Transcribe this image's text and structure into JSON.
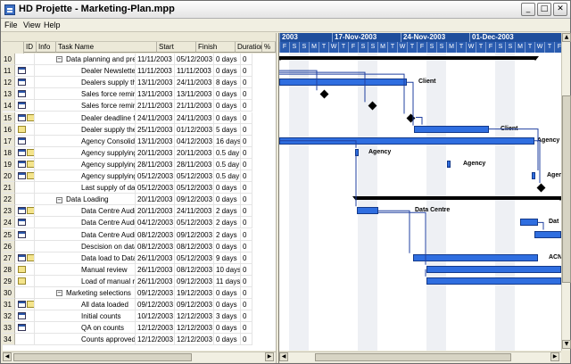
{
  "window": {
    "title": "HD Projette - Marketing-Plan.mpp",
    "minimize": "_",
    "maximize": "□",
    "close": "✕"
  },
  "menu": {
    "file": "File",
    "view": "View",
    "help": "Help"
  },
  "columns": {
    "id": "ID",
    "info": "Info",
    "name": "Task Name",
    "start": "Start",
    "finish": "Finish",
    "duration": "Duration",
    "pct": "%"
  },
  "rows": [
    {
      "id": "10",
      "info": "",
      "name": "Data planning and prep",
      "start": "11/11/2003",
      "finish": "05/12/2003",
      "dur": "0 days",
      "pct": "0",
      "summary": true
    },
    {
      "id": "11",
      "info": "cal",
      "name": "Dealer Newsletter",
      "start": "11/11/2003",
      "finish": "11/11/2003",
      "dur": "0 days",
      "pct": "0"
    },
    {
      "id": "12",
      "info": "cal",
      "name": "Dealers supply the",
      "start": "13/11/2003",
      "finish": "24/11/2003",
      "dur": "8 days",
      "pct": "0"
    },
    {
      "id": "13",
      "info": "cal",
      "name": "Sales force remind",
      "start": "13/11/2003",
      "finish": "13/11/2003",
      "dur": "0 days",
      "pct": "0"
    },
    {
      "id": "14",
      "info": "cal",
      "name": "Sales force remind",
      "start": "21/11/2003",
      "finish": "21/11/2003",
      "dur": "0 days",
      "pct": "0"
    },
    {
      "id": "15",
      "info": "calnote",
      "name": "Dealer deadline for",
      "start": "24/11/2003",
      "finish": "24/11/2003",
      "dur": "0 days",
      "pct": "0"
    },
    {
      "id": "16",
      "info": "note",
      "name": "Dealer supply the c",
      "start": "25/11/2003",
      "finish": "01/12/2003",
      "dur": "5 days",
      "pct": "0"
    },
    {
      "id": "17",
      "info": "cal",
      "name": "Agency Consolidat",
      "start": "13/11/2003",
      "finish": "04/12/2003",
      "dur": "16 days",
      "pct": "0"
    },
    {
      "id": "18",
      "info": "calnote",
      "name": "Agency supplying c",
      "start": "20/11/2003",
      "finish": "20/11/2003",
      "dur": "0.5 day",
      "pct": "0"
    },
    {
      "id": "19",
      "info": "calnote",
      "name": "Agency supplying c",
      "start": "28/11/2003",
      "finish": "28/11/2003",
      "dur": "0.5 day",
      "pct": "0"
    },
    {
      "id": "20",
      "info": "calnote",
      "name": "Agency supplying c",
      "start": "05/12/2003",
      "finish": "05/12/2003",
      "dur": "0.5 day",
      "pct": "0"
    },
    {
      "id": "21",
      "info": "",
      "name": "Last supply of data",
      "start": "05/12/2003",
      "finish": "05/12/2003",
      "dur": "0 days",
      "pct": "0"
    },
    {
      "id": "22",
      "info": "",
      "name": "Data Loading",
      "start": "20/11/2003",
      "finish": "09/12/2003",
      "dur": "0 days",
      "pct": "0",
      "summary": true
    },
    {
      "id": "23",
      "info": "calnote",
      "name": "Data Centre Audit",
      "start": "20/11/2003",
      "finish": "24/11/2003",
      "dur": "2 days",
      "pct": "0"
    },
    {
      "id": "24",
      "info": "cal",
      "name": "Data Centre Audit",
      "start": "04/12/2003",
      "finish": "05/12/2003",
      "dur": "2 days",
      "pct": "0"
    },
    {
      "id": "25",
      "info": "cal",
      "name": "Data Centre Audit",
      "start": "08/12/2003",
      "finish": "09/12/2003",
      "dur": "2 days",
      "pct": "0"
    },
    {
      "id": "26",
      "info": "",
      "name": "Descision on data",
      "start": "08/12/2003",
      "finish": "08/12/2003",
      "dur": "0 days",
      "pct": "0"
    },
    {
      "id": "27",
      "info": "calnote",
      "name": "Data load to Datab",
      "start": "26/11/2003",
      "finish": "05/12/2003",
      "dur": "9 days",
      "pct": "0"
    },
    {
      "id": "28",
      "info": "note",
      "name": "Manual review",
      "start": "26/11/2003",
      "finish": "08/12/2003",
      "dur": "10 days",
      "pct": "0"
    },
    {
      "id": "29",
      "info": "note",
      "name": "Load of manual rev",
      "start": "26/11/2003",
      "finish": "09/12/2003",
      "dur": "11 days",
      "pct": "0"
    },
    {
      "id": "30",
      "info": "",
      "name": "Marketing selections",
      "start": "09/12/2003",
      "finish": "19/12/2003",
      "dur": "0 days",
      "pct": "0",
      "summary": true
    },
    {
      "id": "31",
      "info": "calnote",
      "name": "All data loaded",
      "start": "09/12/2003",
      "finish": "09/12/2003",
      "dur": "0 days",
      "pct": "0"
    },
    {
      "id": "32",
      "info": "cal",
      "name": "Initial counts",
      "start": "10/12/2003",
      "finish": "12/12/2003",
      "dur": "3 days",
      "pct": "0"
    },
    {
      "id": "33",
      "info": "cal",
      "name": "QA on counts",
      "start": "12/12/2003",
      "finish": "12/12/2003",
      "dur": "0 days",
      "pct": "0"
    },
    {
      "id": "34",
      "info": "",
      "name": "Counts approved",
      "start": "12/12/2003",
      "finish": "12/12/2003",
      "dur": "0 days",
      "pct": "0"
    }
  ],
  "timescale": {
    "weeks": [
      "2003",
      "17-Nov-2003",
      "24-Nov-2003",
      "01-Dec-2003"
    ],
    "days": [
      "F",
      "S",
      "S",
      "M",
      "T",
      "W",
      "T",
      "F",
      "S",
      "S",
      "M",
      "T",
      "W",
      "T",
      "F",
      "S",
      "S",
      "M",
      "T",
      "W",
      "T",
      "F",
      "S",
      "S",
      "M",
      "T",
      "W",
      "T",
      "F"
    ]
  },
  "bar_labels": {
    "client1": "Client",
    "client2": "Client",
    "agency_top": "Agency",
    "agency1": "Agency",
    "agency2": "Agency",
    "agency3": "Agency",
    "data_centre": "Data Centre",
    "dat": "Dat",
    "acn": "ACN"
  },
  "colors": {
    "bar": "#2f6ee0",
    "header": "#1f4e9c"
  }
}
